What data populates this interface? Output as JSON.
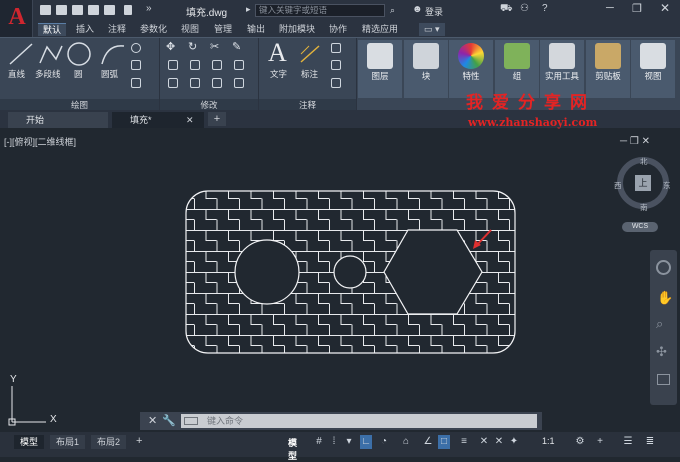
{
  "app": {
    "logo": "A",
    "doc_title": "填充.dwg",
    "search_placeholder": "键入关键字或短语",
    "login": "登录"
  },
  "ribbon_tabs": [
    "默认",
    "插入",
    "注释",
    "参数化",
    "视图",
    "管理",
    "输出",
    "附加模块",
    "协作",
    "精选应用"
  ],
  "ribbon": {
    "draw_tools": [
      "直线",
      "多段线",
      "圆",
      "圆弧"
    ],
    "panels": {
      "draw": "绘图",
      "modify": "修改",
      "annotation": "注释"
    },
    "text_tools": [
      "文字",
      "标注"
    ],
    "big_buttons": [
      "图层",
      "块",
      "特性",
      "组",
      "实用工具",
      "剪贴板",
      "视图"
    ]
  },
  "file_tabs": [
    "开始",
    "填充*"
  ],
  "watermark": {
    "text": "我爱分享网",
    "url": "www.zhanshaoyi.com"
  },
  "viewport_label": "[-][俯视][二维线框]",
  "viewcube": {
    "top": "上",
    "n": "北",
    "s": "南",
    "e": "东",
    "w": "西",
    "wcs": "WCS"
  },
  "ucs": {
    "x": "X",
    "y": "Y"
  },
  "command_placeholder": "键入命令",
  "layout_tabs": [
    "模型",
    "布局1",
    "布局2"
  ],
  "status": {
    "model": "模型",
    "scale": "1:1"
  }
}
